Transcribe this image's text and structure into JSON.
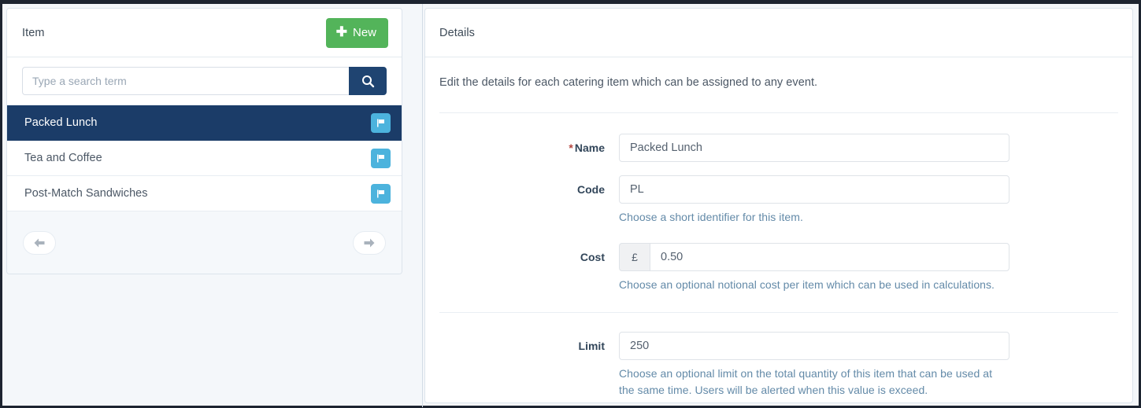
{
  "left_panel": {
    "header_title": "Item",
    "new_button": {
      "label": "New",
      "icon": "plus-icon",
      "color": "#53b45a"
    },
    "search": {
      "placeholder": "Type a search term",
      "value": "",
      "button_icon": "search-icon",
      "button_color": "#1f4471"
    },
    "items": [
      {
        "label": "Packed Lunch",
        "selected": true,
        "badge_icon": "flag-icon"
      },
      {
        "label": "Tea and Coffee",
        "selected": false,
        "badge_icon": "flag-icon"
      },
      {
        "label": "Post-Match Sandwiches",
        "selected": false,
        "badge_icon": "flag-icon"
      }
    ],
    "selected_color": "#1b3c68",
    "badge_color": "#4cb3dd",
    "pager": {
      "prev_icon": "arrow-left-icon",
      "next_icon": "arrow-right-icon"
    }
  },
  "right_panel": {
    "header_title": "Details",
    "intro_text": "Edit the details for each catering item which can be assigned to any event.",
    "fields": {
      "name": {
        "label": "Name",
        "required_marker": "*",
        "value": "Packed Lunch",
        "placeholder": ""
      },
      "code": {
        "label": "Code",
        "value": "PL",
        "placeholder": "",
        "help": "Choose a short identifier for this item."
      },
      "cost": {
        "label": "Cost",
        "currency_symbol": "£",
        "value": "0.50",
        "placeholder": "",
        "help": "Choose an optional notional cost per item which can be used in calculations."
      },
      "limit": {
        "label": "Limit",
        "value": "250",
        "placeholder": "",
        "help": "Choose an optional limit on the total quantity of this item that can be used at the same time. Users will be alerted when this value is exceed."
      }
    }
  },
  "theme": {
    "page_background": "#f4f7fa",
    "card_background": "#ffffff",
    "border": "#dce4ec",
    "help_text_color": "#638aa8",
    "required_color": "#b4453f"
  }
}
